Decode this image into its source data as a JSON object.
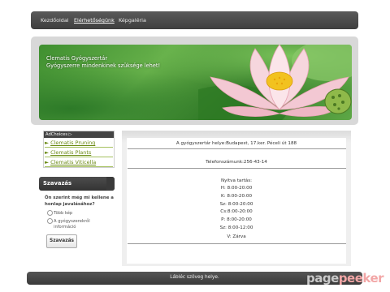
{
  "nav": {
    "items": [
      {
        "label": "Kezdőoldal"
      },
      {
        "label": "Elérhetőségünk",
        "active": true
      },
      {
        "label": "Képgaléria"
      }
    ]
  },
  "hero": {
    "title_line1": "Clematis Gyógyszertár",
    "title_line2": "Gyógyszerre mindenkinek szüksége lehet!"
  },
  "ads": {
    "header": "AdChoices ▷",
    "links": [
      {
        "label": "Clematis Pruning"
      },
      {
        "label": "Clematis Plants"
      },
      {
        "label": "Clematis Viticella"
      }
    ],
    "link_color": "#6b8a14"
  },
  "poll": {
    "heading": "Szavazás",
    "question": "Ön szerint még mi kellene a honlap javulásához?",
    "options": [
      {
        "label_line1": "Több kép",
        "label_line2": ""
      },
      {
        "label_line1": "A gyógyszerekről",
        "label_line2": "információ"
      }
    ],
    "button_label": "Szavazás"
  },
  "content": {
    "address": "A gyógyszertár helye:Budapest, 17.ker. Péceli út 188",
    "phone": "Telefonszámunk:256-43-14",
    "hours_title": "Nyitva tartás:",
    "hours": [
      "H: 8:00-20:00",
      "K: 8:00-20:00",
      "Sz: 8:00-20:00",
      "Cs:8:00-20:00",
      "P: 8:00-20:00",
      "Sz: 8:00-12:00",
      "V: Zárva"
    ]
  },
  "footer": {
    "text": "Lábléc szöveg helye."
  },
  "watermark": {
    "part1": "page",
    "part2": "peeker"
  }
}
